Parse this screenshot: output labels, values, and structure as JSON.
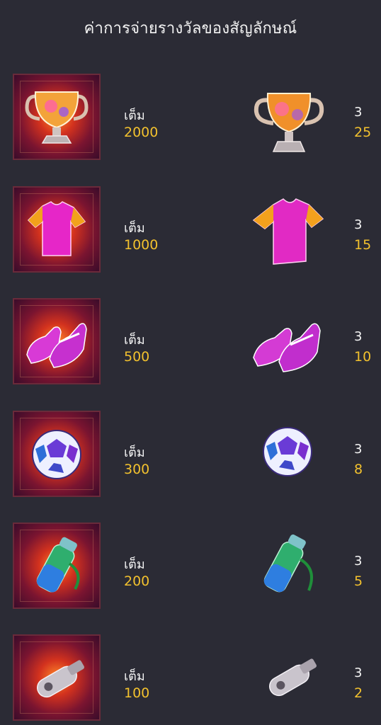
{
  "title": "ค่าการจ่ายรางวัลของสัญลักษณ์",
  "rows": [
    {
      "icon": "trophy-icon",
      "label": "เต็ม",
      "full_value": "2000",
      "count": "3",
      "multiplier": "25"
    },
    {
      "icon": "jersey-icon",
      "label": "เต็ม",
      "full_value": "1000",
      "count": "3",
      "multiplier": "15"
    },
    {
      "icon": "football-boots-icon",
      "label": "เต็ม",
      "full_value": "500",
      "count": "3",
      "multiplier": "10"
    },
    {
      "icon": "football-icon",
      "label": "เต็ม",
      "full_value": "300",
      "count": "3",
      "multiplier": "8"
    },
    {
      "icon": "water-bottle-icon",
      "label": "เต็ม",
      "full_value": "200",
      "count": "3",
      "multiplier": "5"
    },
    {
      "icon": "whistle-icon",
      "label": "เต็ม",
      "full_value": "100",
      "count": "3",
      "multiplier": "2"
    }
  ],
  "colors": {
    "background": "#2b2b35",
    "value_yellow": "#f2c12e",
    "text_white": "#f4f4f4"
  }
}
